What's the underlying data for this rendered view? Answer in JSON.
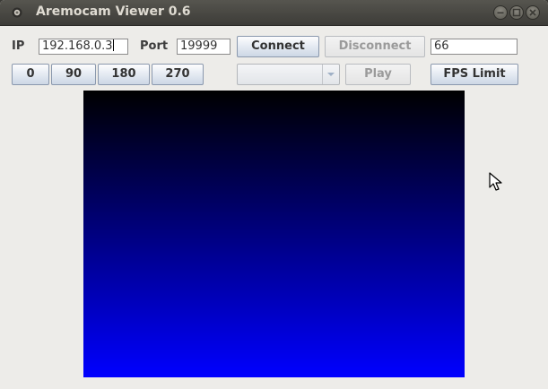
{
  "window": {
    "title": "Aremocam Viewer 0.6",
    "controls": [
      "minimize-icon",
      "maximize-icon",
      "close-icon"
    ]
  },
  "connection": {
    "ip_label": "IP",
    "ip_value": "192.168.0.3",
    "port_label": "Port",
    "port_value": "19999",
    "connect_label": "Connect",
    "disconnect_label": "Disconnect",
    "disconnect_enabled": false,
    "fps_value": "66"
  },
  "rotation": {
    "buttons": [
      "0",
      "90",
      "180",
      "270"
    ]
  },
  "playback": {
    "combo_value": "",
    "combo_enabled": false,
    "play_label": "Play",
    "play_enabled": false,
    "fps_limit_label": "FPS Limit"
  },
  "video": {
    "gradient_top": "#000000",
    "gradient_bottom": "#0000ff"
  },
  "colors": {
    "titlebar": "#3d3c38",
    "background": "#edece9",
    "button_border": "#8a98ad"
  }
}
